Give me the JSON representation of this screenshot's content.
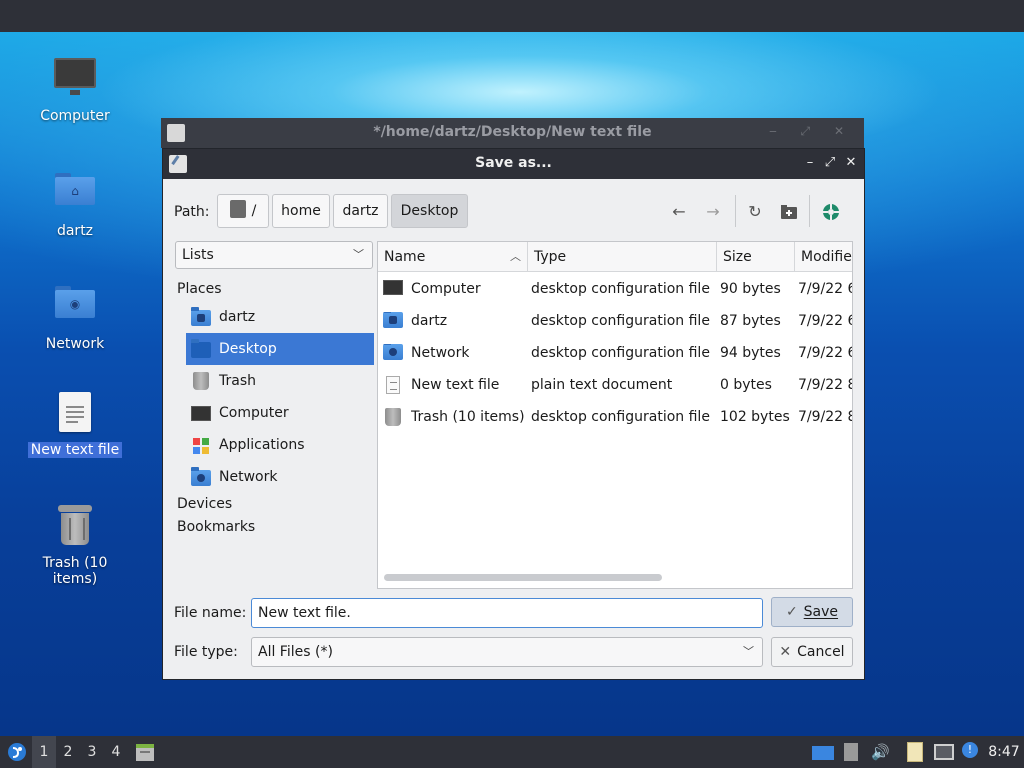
{
  "desktop": {
    "icons": [
      {
        "label": "Computer",
        "icon": "monitor-icon"
      },
      {
        "label": "dartz",
        "icon": "home-folder-icon"
      },
      {
        "label": "Network",
        "icon": "network-folder-icon"
      },
      {
        "label": "New text file",
        "icon": "text-file-icon"
      },
      {
        "label": "Trash (10 items)",
        "icon": "trash-icon"
      }
    ]
  },
  "editor_window": {
    "title": "*/home/dartz/Desktop/New text file"
  },
  "dialog": {
    "title": "Save as...",
    "path_label": "Path:",
    "breadcrumbs": [
      "/",
      "home",
      "dartz",
      "Desktop"
    ],
    "active_crumb": "Desktop",
    "toolbar": [
      "back-arrow-icon",
      "forward-arrow-icon",
      "reload-icon",
      "new-folder-icon",
      "bookmark-icon"
    ],
    "side_view_combo": "Lists",
    "places": {
      "header": "Places",
      "items": [
        {
          "label": "dartz",
          "icon": "home-folder-icon"
        },
        {
          "label": "Desktop",
          "icon": "desktop-icon",
          "selected": true
        },
        {
          "label": "Trash",
          "icon": "trash-icon"
        },
        {
          "label": "Computer",
          "icon": "computer-icon"
        },
        {
          "label": "Applications",
          "icon": "applications-icon"
        },
        {
          "label": "Network",
          "icon": "network-folder-icon"
        }
      ],
      "devices": "Devices",
      "bookmarks": "Bookmarks"
    },
    "columns": [
      "Name",
      "Type",
      "Size",
      "Modifie"
    ],
    "files": [
      {
        "name": "Computer",
        "type": "desktop configuration file",
        "size": "90 bytes",
        "modified": "7/9/22 6",
        "icon": "monitor-icon"
      },
      {
        "name": "dartz",
        "type": "desktop configuration file",
        "size": "87 bytes",
        "modified": "7/9/22 6",
        "icon": "home-folder-icon"
      },
      {
        "name": "Network",
        "type": "desktop configuration file",
        "size": "94 bytes",
        "modified": "7/9/22 6",
        "icon": "network-folder-icon"
      },
      {
        "name": "New text file",
        "type": "plain text document",
        "size": "0 bytes",
        "modified": "7/9/22 8",
        "icon": "text-file-icon"
      },
      {
        "name": "Trash (10 items)",
        "type": "desktop configuration file",
        "size": "102 bytes",
        "modified": "7/9/22 8",
        "icon": "trash-icon"
      }
    ],
    "file_name_label": "File name:",
    "file_name_value": "New text file.",
    "file_type_label": "File type:",
    "file_type_value": "All Files (*)",
    "save_label": "Save",
    "cancel_label": "Cancel"
  },
  "taskbar": {
    "workspaces": [
      "1",
      "2",
      "3",
      "4"
    ],
    "current_workspace": "1",
    "clock": "8:47"
  },
  "colors": {
    "selection": "#3b78d4",
    "panel": "#2e3038",
    "desktop_blue": "#0b4fae"
  }
}
